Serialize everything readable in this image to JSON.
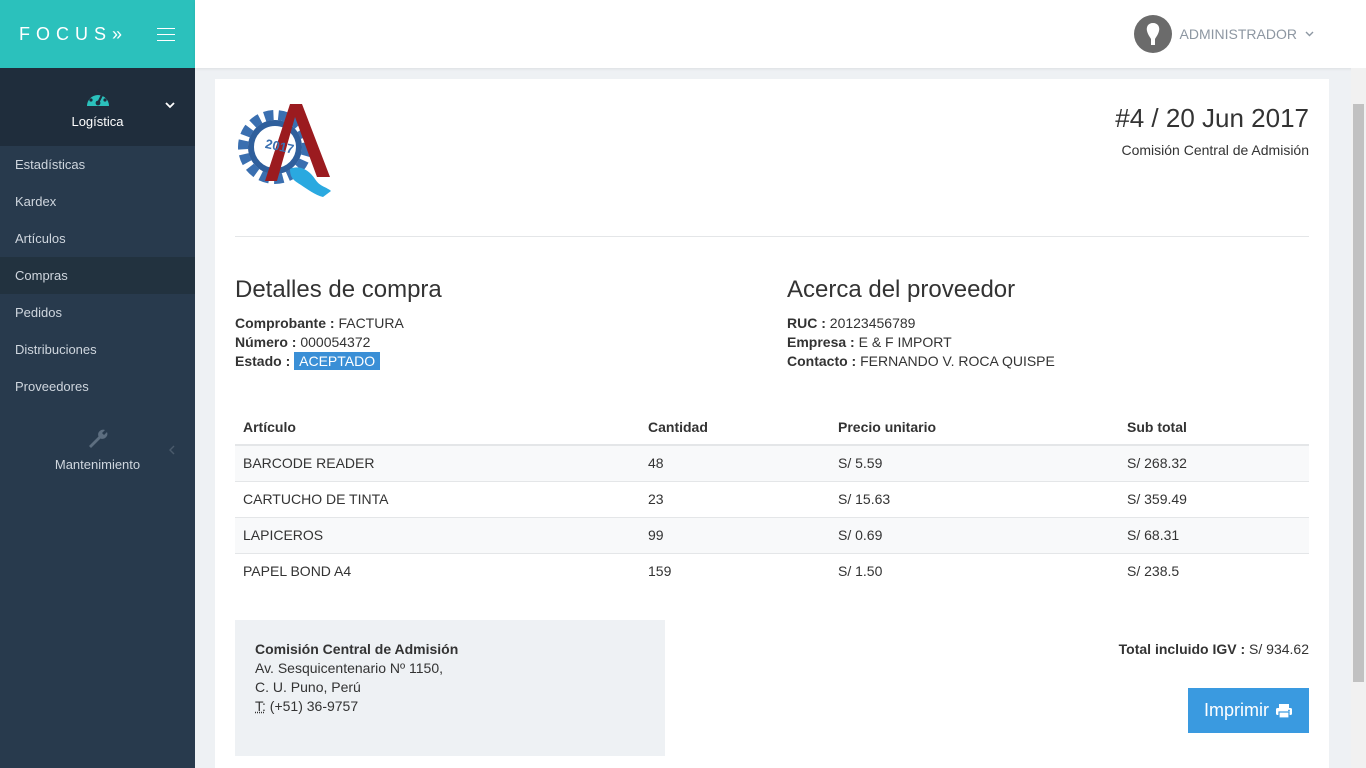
{
  "brand": "FOCUS»",
  "user": {
    "name": "ADMINISTRADOR"
  },
  "sidebar": {
    "section_label": "Logística",
    "items": [
      {
        "label": "Estadísticas",
        "active": false
      },
      {
        "label": "Kardex",
        "active": false
      },
      {
        "label": "Artículos",
        "active": false
      },
      {
        "label": "Compras",
        "active": true
      },
      {
        "label": "Pedidos",
        "active": false
      },
      {
        "label": "Distribuciones",
        "active": false
      },
      {
        "label": "Proveedores",
        "active": false
      }
    ],
    "maintenance_label": "Mantenimiento"
  },
  "invoice": {
    "title": "#4 / 20 Jun 2017",
    "subtitle": "Comisión Central de Admisión",
    "logo_text": "2017"
  },
  "purchase": {
    "heading": "Detalles de compra",
    "comprobante_label": "Comprobante :",
    "comprobante": "FACTURA",
    "numero_label": "Número :",
    "numero": "000054372",
    "estado_label": "Estado :",
    "estado": "ACEPTADO"
  },
  "supplier": {
    "heading": "Acerca del proveedor",
    "ruc_label": "RUC :",
    "ruc": "20123456789",
    "empresa_label": "Empresa :",
    "empresa": "E & F IMPORT",
    "contacto_label": "Contacto :",
    "contacto": "FERNANDO V. ROCA QUISPE"
  },
  "table": {
    "headers": [
      "Artículo",
      "Cantidad",
      "Precio unitario",
      "Sub total"
    ],
    "rows": [
      [
        "BARCODE READER",
        "48",
        "S/ 5.59",
        "S/ 268.32"
      ],
      [
        "CARTUCHO DE TINTA",
        "23",
        "S/ 15.63",
        "S/ 359.49"
      ],
      [
        "LAPICEROS",
        "99",
        "S/ 0.69",
        "S/ 68.31"
      ],
      [
        "PAPEL BOND A4",
        "159",
        "S/ 1.50",
        "S/ 238.5"
      ]
    ]
  },
  "address": {
    "name": "Comisión Central de Admisión",
    "line1": "Av. Sesquicentenario Nº 1150,",
    "line2": "C. U. Puno, Perú",
    "phone_label": "T:",
    "phone": " (+51) 36-9757"
  },
  "total": {
    "label": "Total incluido IGV :",
    "value": " S/ 934.62"
  },
  "print_label": "Imprimir",
  "colors": {
    "brand": "#2bc1bc",
    "sidebar": "#283a4d",
    "accent": "#3a9ae0",
    "badge": "#3a8fd6"
  }
}
